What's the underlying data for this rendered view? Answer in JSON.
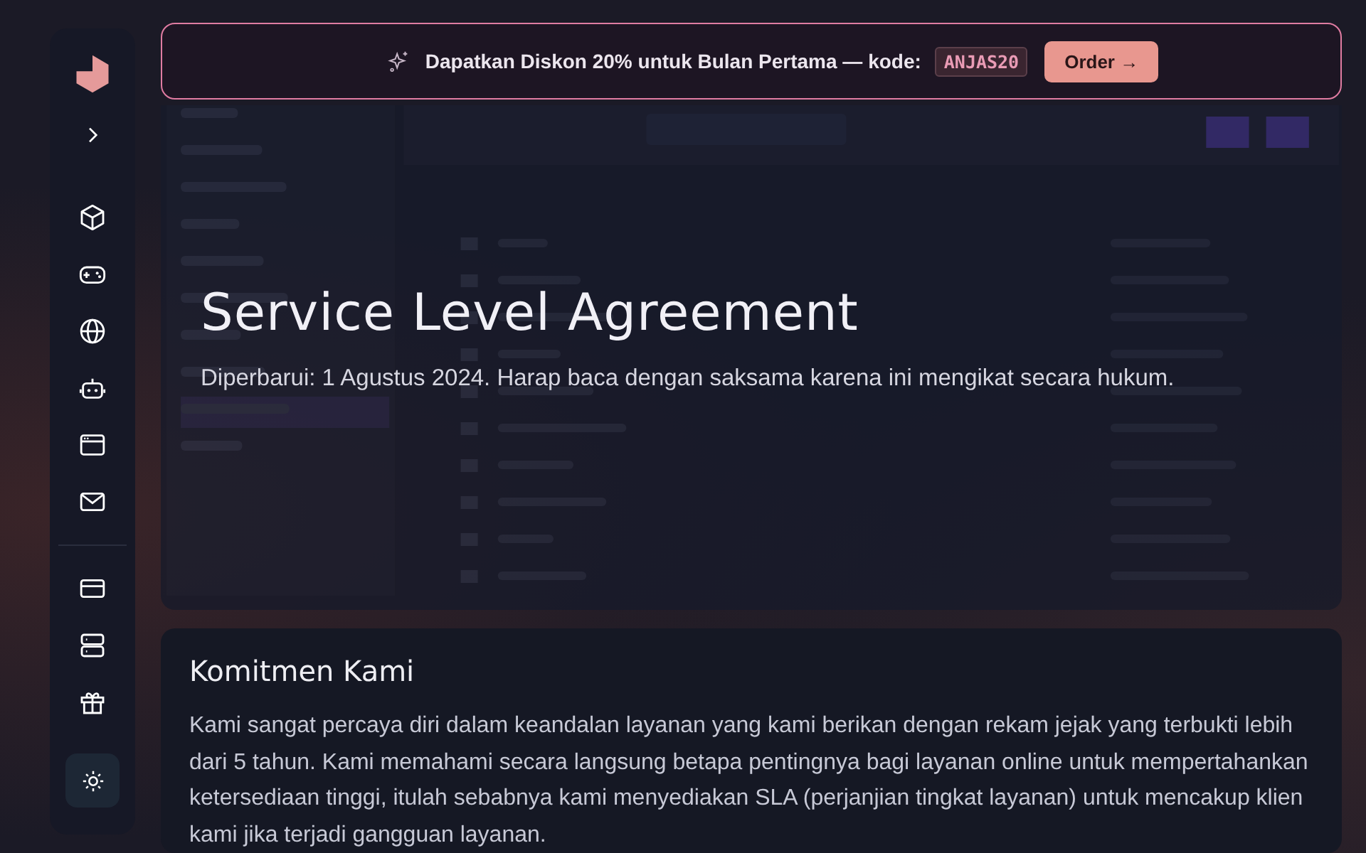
{
  "promo": {
    "text": "Dapatkan Diskon 20% untuk Bulan Pertama — kode:",
    "code": "ANJAS20",
    "button": "Order →"
  },
  "hero": {
    "title": "Service Level Agreement",
    "subtitle": "Diperbarui: 1 Agustus 2024. Harap baca dengan saksama karena ini mengikat secara hukum."
  },
  "sections": [
    {
      "heading": "Komitmen Kami",
      "body": "Kami sangat percaya diri dalam keandalan layanan yang kami berikan dengan rekam jejak yang terbukti lebih dari 5 tahun. Kami memahami secara langsung betapa pentingnya bagi layanan online untuk mempertahankan ketersediaan tinggi, itulah sebabnya kami menyediakan SLA (perjanjian tingkat layanan) untuk mencakup klien kami jika terjadi gangguan layanan."
    }
  ]
}
